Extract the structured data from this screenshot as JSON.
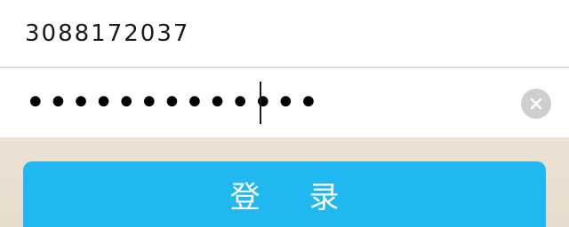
{
  "account": {
    "value": "3088172037"
  },
  "password": {
    "masked_value": "•••••••••••••",
    "clear_icon": "clear-circle-x"
  },
  "login": {
    "label": "登 录",
    "color": "#21b8f2"
  }
}
